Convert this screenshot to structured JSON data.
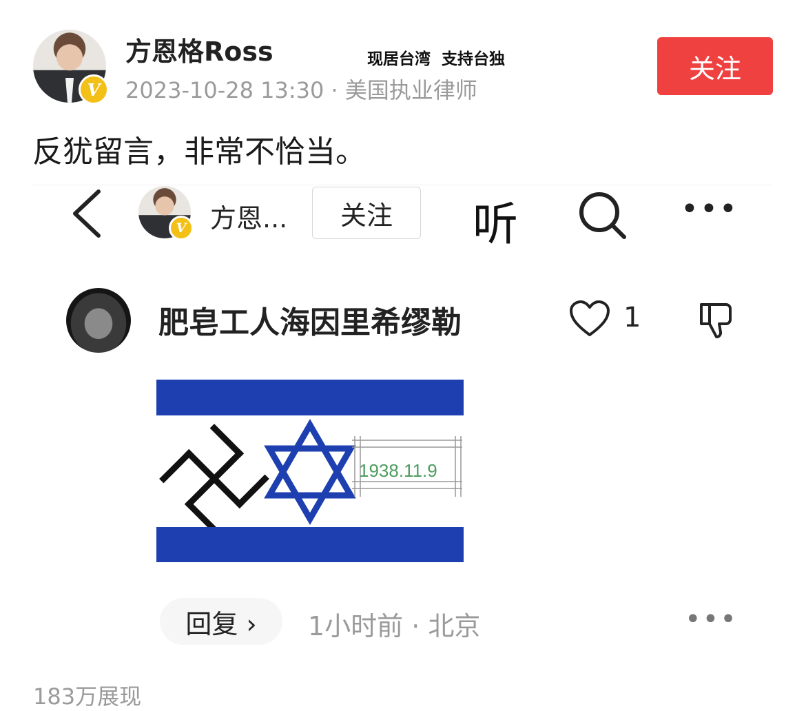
{
  "post": {
    "author": "方恩格Ross",
    "slogan": "现居台湾  支持台独",
    "meta": "2023-10-28 13:30 · 美国执业律师",
    "follow_label": "关注",
    "text": "反犹留言，非常不恰当。",
    "views": "183万展现",
    "verified_badge": "V"
  },
  "screenshot": {
    "nav": {
      "name": "方恩...",
      "follow_label": "关注",
      "listen_label": "听",
      "more": "•••"
    },
    "comment": {
      "username": "肥皂工人海因里希缪勒",
      "likes": "1",
      "image_text": "1938.11.9",
      "reply_label": "回复 ›",
      "meta": "1小时前 · 北京",
      "more": "•••"
    }
  },
  "colors": {
    "follow_red": "#f04141",
    "badge_gold": "#f3c017",
    "flag_blue": "#1d3fb0",
    "meta_gray": "#9a9a9a"
  }
}
